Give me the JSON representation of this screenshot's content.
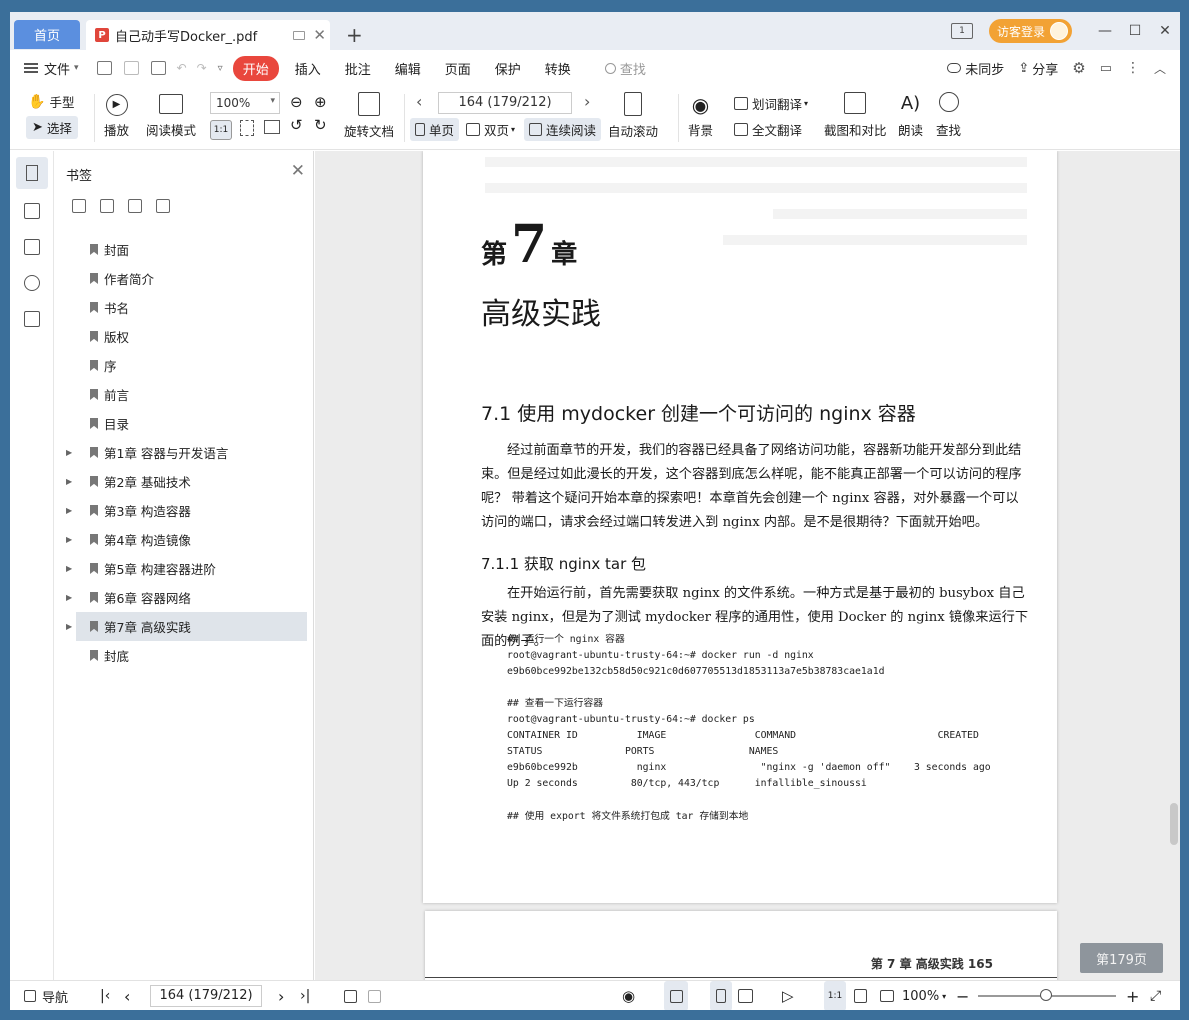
{
  "titlebar": {
    "home_tab": "首页",
    "doc_tab_title": "自己动手写Docker_.pdf",
    "login_label": "访客登录"
  },
  "menubar": {
    "file": "文件",
    "start": "开始",
    "items": [
      "插入",
      "批注",
      "编辑",
      "页面",
      "保护",
      "转换"
    ],
    "search_placeholder": "查找",
    "sync_status": "未同步",
    "share": "分享"
  },
  "toolbar": {
    "hand": "手型",
    "select": "选择",
    "play": "播放",
    "read_mode": "阅读模式",
    "zoom": "100%",
    "rotate": "旋转文档",
    "page_indicator": "164 (179/212)",
    "single_page": "单页",
    "double_page": "双页",
    "continuous": "连续阅读",
    "auto_scroll": "自动滚动",
    "background": "背景",
    "word_translate": "划词翻译",
    "full_translate": "全文翻译",
    "screenshot_compare": "截图和对比",
    "read_aloud": "朗读",
    "find": "查找"
  },
  "bookmarks": {
    "title": "书签",
    "items": [
      {
        "label": "封面",
        "expandable": false
      },
      {
        "label": "作者简介",
        "expandable": false
      },
      {
        "label": "书名",
        "expandable": false
      },
      {
        "label": "版权",
        "expandable": false
      },
      {
        "label": "序",
        "expandable": false
      },
      {
        "label": "前言",
        "expandable": false
      },
      {
        "label": "目录",
        "expandable": false
      },
      {
        "label": "第1章 容器与开发语言",
        "expandable": true
      },
      {
        "label": "第2章 基础技术",
        "expandable": true
      },
      {
        "label": "第3章 构造容器",
        "expandable": true
      },
      {
        "label": "第4章 构造镜像",
        "expandable": true
      },
      {
        "label": "第5章 构建容器进阶",
        "expandable": true
      },
      {
        "label": "第6章 容器网络",
        "expandable": true
      },
      {
        "label": "第7章 高级实践",
        "expandable": true,
        "active": true
      },
      {
        "label": "封底",
        "expandable": false
      }
    ]
  },
  "page": {
    "chapter_prefix": "第",
    "chapter_number": "7",
    "chapter_suffix": "章",
    "chapter_title": "高级实践",
    "section_title": "7.1   使用 mydocker 创建一个可访问的 nginx 容器",
    "para1": "经过前面章节的开发，我们的容器已经具备了网络访问功能，容器新功能开发部分到此结束。但是经过如此漫长的开发，这个容器到底怎么样呢，能不能真正部署一个可以访问的程序呢？ 带着这个疑问开始本章的探索吧！本章首先会创建一个 nginx 容器，对外暴露一个可以访问的端口，请求会经过端口转发进入到 nginx 内部。是不是很期待？下面就开始吧。",
    "subsection_title": "7.1.1   获取 nginx tar 包",
    "para2": "在开始运行前，首先需要获取 nginx 的文件系统。一种方式是基于最初的 busybox 自己安装 nginx，但是为了测试 mydocker 程序的通用性，使用 Docker 的 nginx 镜像来运行下面的例子。",
    "code1": "## 运行一个 nginx 容器\nroot@vagrant-ubuntu-trusty-64:~# docker run -d nginx\ne9b60bce992be132cb58d50c921c0d607705513d1853113a7e5b38783cae1a1d",
    "code2": "## 查看一下运行容器\nroot@vagrant-ubuntu-trusty-64:~# docker ps\nCONTAINER ID          IMAGE               COMMAND                        CREATED\nSTATUS              PORTS                NAMES\ne9b60bce992b          nginx                \"nginx -g 'daemon off\"    3 seconds ago\nUp 2 seconds         80/tcp, 443/tcp      infallible_sinoussi",
    "code3": "## 使用 export 将文件系统打包成 tar 存储到本地",
    "footer_running": "第 7 章    高级实践    165",
    "page_badge": "第179页"
  },
  "statusbar": {
    "nav": "导航",
    "page_indicator": "164 (179/212)",
    "zoom": "100%"
  }
}
